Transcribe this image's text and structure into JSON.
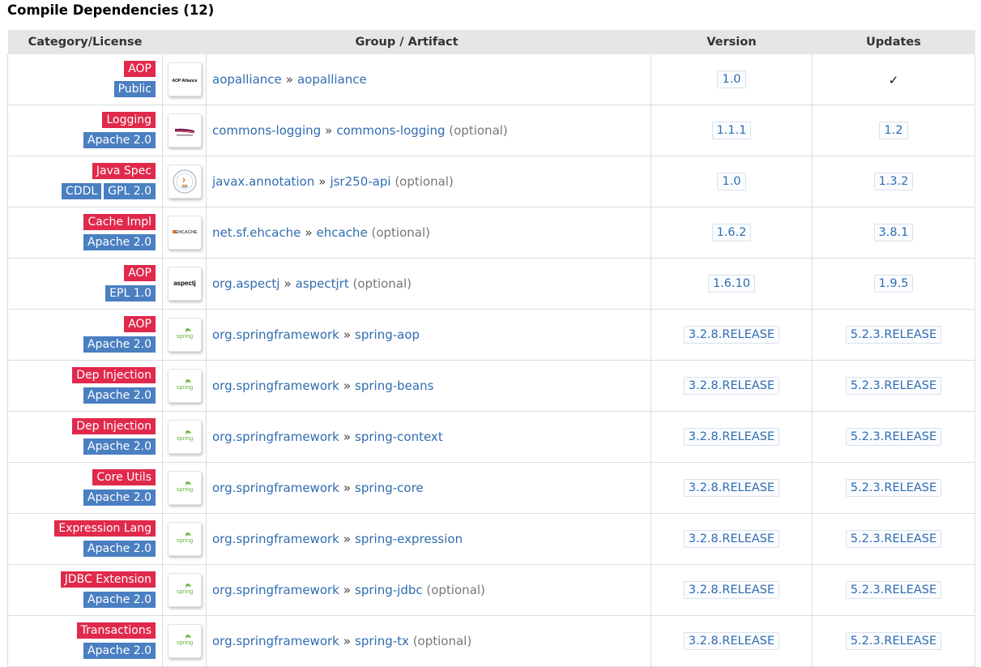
{
  "title": "Compile Dependencies (12)",
  "headers": {
    "category": "Category/License",
    "artifact": "Group / Artifact",
    "version": "Version",
    "updates": "Updates"
  },
  "separator": "»",
  "rows": [
    {
      "categories": [
        "AOP"
      ],
      "licenses": [
        "Public"
      ],
      "logo": "aop-alliance-logo",
      "group": "aopalliance",
      "artifact": "aopalliance",
      "optional": "",
      "version": "1.0",
      "update": "✓",
      "update_is_check": true
    },
    {
      "categories": [
        "Logging"
      ],
      "licenses": [
        "Apache 2.0"
      ],
      "logo": "apache-commons-logo",
      "group": "commons-logging",
      "artifact": "commons-logging",
      "optional": "(optional)",
      "version": "1.1.1",
      "update": "1.2",
      "update_is_check": false
    },
    {
      "categories": [
        "Java Spec"
      ],
      "licenses": [
        "CDDL",
        "GPL 2.0"
      ],
      "logo": "java-ee-logo",
      "group": "javax.annotation",
      "artifact": "jsr250-api",
      "optional": "(optional)",
      "version": "1.0",
      "update": "1.3.2",
      "update_is_check": false
    },
    {
      "categories": [
        "Cache Impl"
      ],
      "licenses": [
        "Apache 2.0"
      ],
      "logo": "ehcache-logo",
      "group": "net.sf.ehcache",
      "artifact": "ehcache",
      "optional": "(optional)",
      "version": "1.6.2",
      "update": "3.8.1",
      "update_is_check": false
    },
    {
      "categories": [
        "AOP"
      ],
      "licenses": [
        "EPL 1.0"
      ],
      "logo": "aspectj-logo",
      "group": "org.aspectj",
      "artifact": "aspectjrt",
      "optional": "(optional)",
      "version": "1.6.10",
      "update": "1.9.5",
      "update_is_check": false
    },
    {
      "categories": [
        "AOP"
      ],
      "licenses": [
        "Apache 2.0"
      ],
      "logo": "spring-logo",
      "group": "org.springframework",
      "artifact": "spring-aop",
      "optional": "",
      "version": "3.2.8.RELEASE",
      "update": "5.2.3.RELEASE",
      "update_is_check": false
    },
    {
      "categories": [
        "Dep Injection"
      ],
      "licenses": [
        "Apache 2.0"
      ],
      "logo": "spring-logo",
      "group": "org.springframework",
      "artifact": "spring-beans",
      "optional": "",
      "version": "3.2.8.RELEASE",
      "update": "5.2.3.RELEASE",
      "update_is_check": false
    },
    {
      "categories": [
        "Dep Injection"
      ],
      "licenses": [
        "Apache 2.0"
      ],
      "logo": "spring-logo",
      "group": "org.springframework",
      "artifact": "spring-context",
      "optional": "",
      "version": "3.2.8.RELEASE",
      "update": "5.2.3.RELEASE",
      "update_is_check": false
    },
    {
      "categories": [
        "Core Utils"
      ],
      "licenses": [
        "Apache 2.0"
      ],
      "logo": "spring-logo",
      "group": "org.springframework",
      "artifact": "spring-core",
      "optional": "",
      "version": "3.2.8.RELEASE",
      "update": "5.2.3.RELEASE",
      "update_is_check": false
    },
    {
      "categories": [
        "Expression Lang"
      ],
      "licenses": [
        "Apache 2.0"
      ],
      "logo": "spring-logo",
      "group": "org.springframework",
      "artifact": "spring-expression",
      "optional": "",
      "version": "3.2.8.RELEASE",
      "update": "5.2.3.RELEASE",
      "update_is_check": false
    },
    {
      "categories": [
        "JDBC Extension"
      ],
      "licenses": [
        "Apache 2.0"
      ],
      "logo": "spring-logo",
      "group": "org.springframework",
      "artifact": "spring-jdbc",
      "optional": "(optional)",
      "version": "3.2.8.RELEASE",
      "update": "5.2.3.RELEASE",
      "update_is_check": false
    },
    {
      "categories": [
        "Transactions"
      ],
      "licenses": [
        "Apache 2.0"
      ],
      "logo": "spring-logo",
      "group": "org.springframework",
      "artifact": "spring-tx",
      "optional": "(optional)",
      "version": "3.2.8.RELEASE",
      "update": "5.2.3.RELEASE",
      "update_is_check": false
    }
  ],
  "logo_text": {
    "aop-alliance-logo": "AOP Alliance",
    "ehcache-logo": "EHCACHE",
    "aspectj-logo": "aspectj",
    "spring-logo": "spring"
  },
  "colors": {
    "category_badge": "#e0294b",
    "license_badge": "#4a7fc1",
    "link": "#2f6cb0",
    "header_bg": "#e6e6e6"
  }
}
